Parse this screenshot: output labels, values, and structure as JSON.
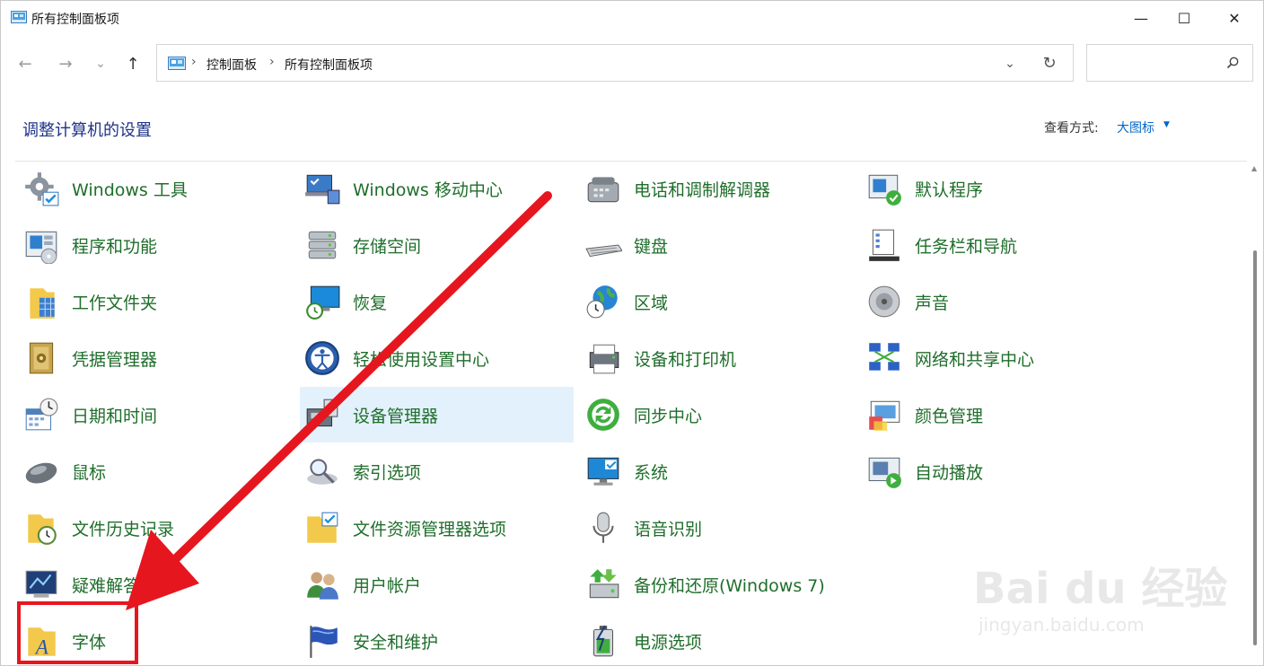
{
  "window": {
    "title": "所有控制面板项",
    "buttons": {
      "minimize": "—",
      "maximize": "☐",
      "close": "✕"
    }
  },
  "nav": {
    "back": "←",
    "forward": "→",
    "recent": "⌄",
    "up": "↑",
    "breadcrumbs": [
      "控制面板",
      "所有控制面板项"
    ],
    "separator": "›",
    "dropdown": "⌄",
    "refresh": "↻",
    "search_placeholder": ""
  },
  "header": {
    "title": "调整计算机的设置",
    "view_label": "查看方式:",
    "view_value": "大图标",
    "view_caret": "▼"
  },
  "items": [
    {
      "label": "Windows 工具",
      "icon": "gear-tools-icon"
    },
    {
      "label": "程序和功能",
      "icon": "programs-icon"
    },
    {
      "label": "工作文件夹",
      "icon": "work-folders-icon"
    },
    {
      "label": "凭据管理器",
      "icon": "credential-safe-icon"
    },
    {
      "label": "日期和时间",
      "icon": "calendar-clock-icon"
    },
    {
      "label": "鼠标",
      "icon": "mouse-icon"
    },
    {
      "label": "文件历史记录",
      "icon": "file-history-icon"
    },
    {
      "label": "疑难解答",
      "icon": "troubleshoot-icon"
    },
    {
      "label": "字体",
      "icon": "fonts-folder-icon"
    },
    {
      "label": "Windows 移动中心",
      "icon": "mobility-center-icon"
    },
    {
      "label": "存储空间",
      "icon": "storage-spaces-icon"
    },
    {
      "label": "恢复",
      "icon": "recovery-icon"
    },
    {
      "label": "轻松使用设置中心",
      "icon": "ease-of-access-icon"
    },
    {
      "label": "设备管理器",
      "icon": "device-manager-icon"
    },
    {
      "label": "索引选项",
      "icon": "indexing-icon"
    },
    {
      "label": "文件资源管理器选项",
      "icon": "explorer-options-icon"
    },
    {
      "label": "用户帐户",
      "icon": "user-accounts-icon"
    },
    {
      "label": "安全和维护",
      "icon": "security-flag-icon"
    },
    {
      "label": "电话和调制解调器",
      "icon": "phone-modem-icon"
    },
    {
      "label": "键盘",
      "icon": "keyboard-icon"
    },
    {
      "label": "区域",
      "icon": "region-globe-icon"
    },
    {
      "label": "设备和打印机",
      "icon": "printer-icon"
    },
    {
      "label": "同步中心",
      "icon": "sync-icon"
    },
    {
      "label": "系统",
      "icon": "system-monitor-icon"
    },
    {
      "label": "语音识别",
      "icon": "microphone-icon"
    },
    {
      "label": "备份和还原(Windows 7)",
      "icon": "backup-icon"
    },
    {
      "label": "电源选项",
      "icon": "power-battery-icon"
    },
    {
      "label": "默认程序",
      "icon": "default-programs-icon"
    },
    {
      "label": "任务栏和导航",
      "icon": "taskbar-icon"
    },
    {
      "label": "声音",
      "icon": "speaker-icon"
    },
    {
      "label": "网络和共享中心",
      "icon": "network-icon"
    },
    {
      "label": "颜色管理",
      "icon": "color-management-icon"
    },
    {
      "label": "自动播放",
      "icon": "autoplay-icon"
    }
  ],
  "selected_item": "设备管理器",
  "highlighted_item": "字体",
  "watermark": {
    "main": "Bai du 经验",
    "sub": "jingyan.baidu.com"
  },
  "colors": {
    "item_text": "#1f6e2b",
    "title": "#1e3287",
    "link": "#0066cc",
    "selection": "#e3f1fc",
    "annotation": "#e6161f"
  }
}
